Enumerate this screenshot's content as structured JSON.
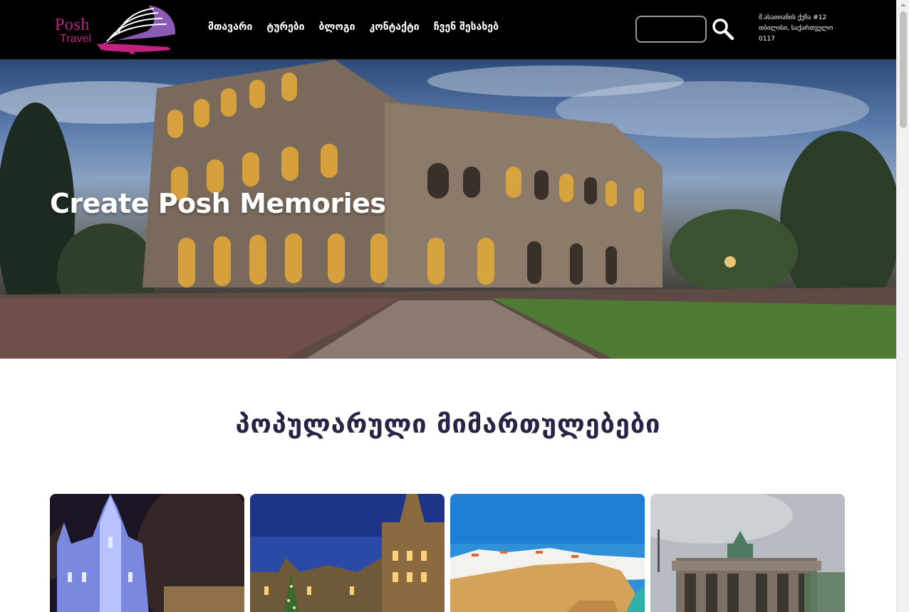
{
  "logo": {
    "line1": "Posh",
    "line2": "Travel",
    "brand_color": "#c1227f",
    "accent_color": "#8a5ab5"
  },
  "nav": {
    "items": [
      {
        "label": "მთავარი"
      },
      {
        "label": "ტურები"
      },
      {
        "label": "ბლოგი"
      },
      {
        "label": "კონტაქტი"
      },
      {
        "label": "ჩვენ შესახებ"
      }
    ]
  },
  "search": {
    "placeholder": "",
    "icon": "search-icon"
  },
  "address": {
    "line1": "მ.ასათიანის ქუჩა #12",
    "line2": "თბილისი, საქართველო",
    "line3": "0117"
  },
  "hero": {
    "title": "Create Posh Memories",
    "image": "colosseum-photo"
  },
  "popular": {
    "title": "პოპულარული მიმართულებები",
    "title_color": "#2a2346",
    "cards": [
      {
        "image": "vienna-city-hall-photo"
      },
      {
        "image": "brussels-grand-place-photo"
      },
      {
        "image": "algarve-coast-photo"
      },
      {
        "image": "brandenburg-gate-photo"
      }
    ]
  }
}
